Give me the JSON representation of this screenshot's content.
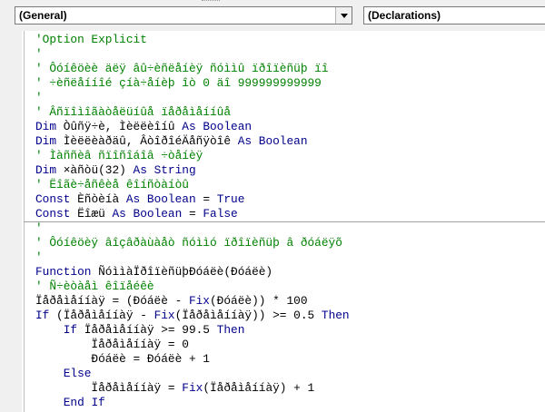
{
  "toolbar": {
    "object_combo": "(General)",
    "procedure_combo": "(Declarations)"
  },
  "colors": {
    "comment": "#008000",
    "keyword": "#00008b",
    "text": "#000000"
  },
  "code_lines": [
    {
      "type": "comment",
      "text": "'Option Explicit"
    },
    {
      "type": "comment",
      "text": "'"
    },
    {
      "type": "comment",
      "text": "' Ôóíêöèè äëÿ âû÷èñëåíèÿ ñóììû ïðîïèñüþ ïî"
    },
    {
      "type": "comment",
      "text": "' ÷èñëåííîé çíà÷åíèþ îò 0 äî 999999999999"
    },
    {
      "type": "comment",
      "text": "'"
    },
    {
      "type": "comment",
      "text": "' Âñïîìîãàòåëüíûå ïåðåìåííûå"
    },
    {
      "type": "code",
      "text": "Dim Òûñÿ÷è, Ìèëëèîíû As Boolean"
    },
    {
      "type": "code",
      "text": "Dim Ìèëëèàðäû, ÂòîðîéÄåñÿòîê As Boolean"
    },
    {
      "type": "comment",
      "text": "' Ìàññèâ ñïîñîáîâ ÷òåíèÿ"
    },
    {
      "type": "code",
      "text": "Dim ×àñòü(32) As String"
    },
    {
      "type": "comment",
      "text": "' Ëîãè÷åñêèå êîíñòàíòû"
    },
    {
      "type": "code",
      "text": "Const Èñòèíà As Boolean = True"
    },
    {
      "type": "code",
      "text": "Const Ëîæü As Boolean = False"
    },
    {
      "type": "comment",
      "text": "'"
    },
    {
      "type": "comment",
      "text": "' Ôóíêöèÿ âîçâðàùàåò ñóììó ïðîïèñüþ â ðóáëÿõ"
    },
    {
      "type": "comment",
      "text": "'"
    },
    {
      "type": "code",
      "text": "Function ÑóììàÏðîïèñüþÐóáëè(Ðóáëè)"
    },
    {
      "type": "comment",
      "text": "' Ñ÷èòàåì êîïåéêè"
    },
    {
      "type": "code",
      "text": "Ïåðåìåííàÿ = (Ðóáëè - Fix(Ðóáëè)) * 100"
    },
    {
      "type": "code",
      "text": "If (Ïåðåìåííàÿ - Fix(Ïåðåìåííàÿ)) >= 0.5 Then"
    },
    {
      "type": "code",
      "text": "    If Ïåðåìåííàÿ >= 99.5 Then"
    },
    {
      "type": "code",
      "text": "        Ïåðåìåííàÿ = 0"
    },
    {
      "type": "code",
      "text": "        Ðóáëè = Ðóáëè + 1"
    },
    {
      "type": "code",
      "text": "    Else"
    },
    {
      "type": "code",
      "text": "        Ïåðåìåííàÿ = Fix(Ïåðåìåííàÿ) + 1"
    },
    {
      "type": "code",
      "text": "    End If"
    }
  ]
}
